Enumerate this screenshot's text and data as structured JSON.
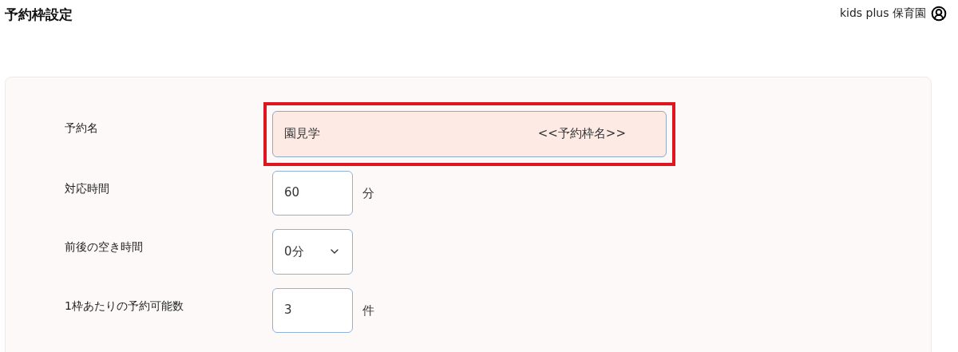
{
  "header": {
    "title": "予約枠設定",
    "account": "kids plus 保育園"
  },
  "form": {
    "rows": [
      {
        "kind": "text",
        "label": "予約名",
        "value": "園見学",
        "tag": "<<予約枠名>>",
        "highlighted": true
      },
      {
        "kind": "number",
        "label": "対応時間",
        "value": "60",
        "unit": "分"
      },
      {
        "kind": "select",
        "label": "前後の空き時間",
        "value": "0分"
      },
      {
        "kind": "number",
        "label": "1枠あたりの予約可能数",
        "value": "3",
        "unit": "件"
      }
    ]
  }
}
